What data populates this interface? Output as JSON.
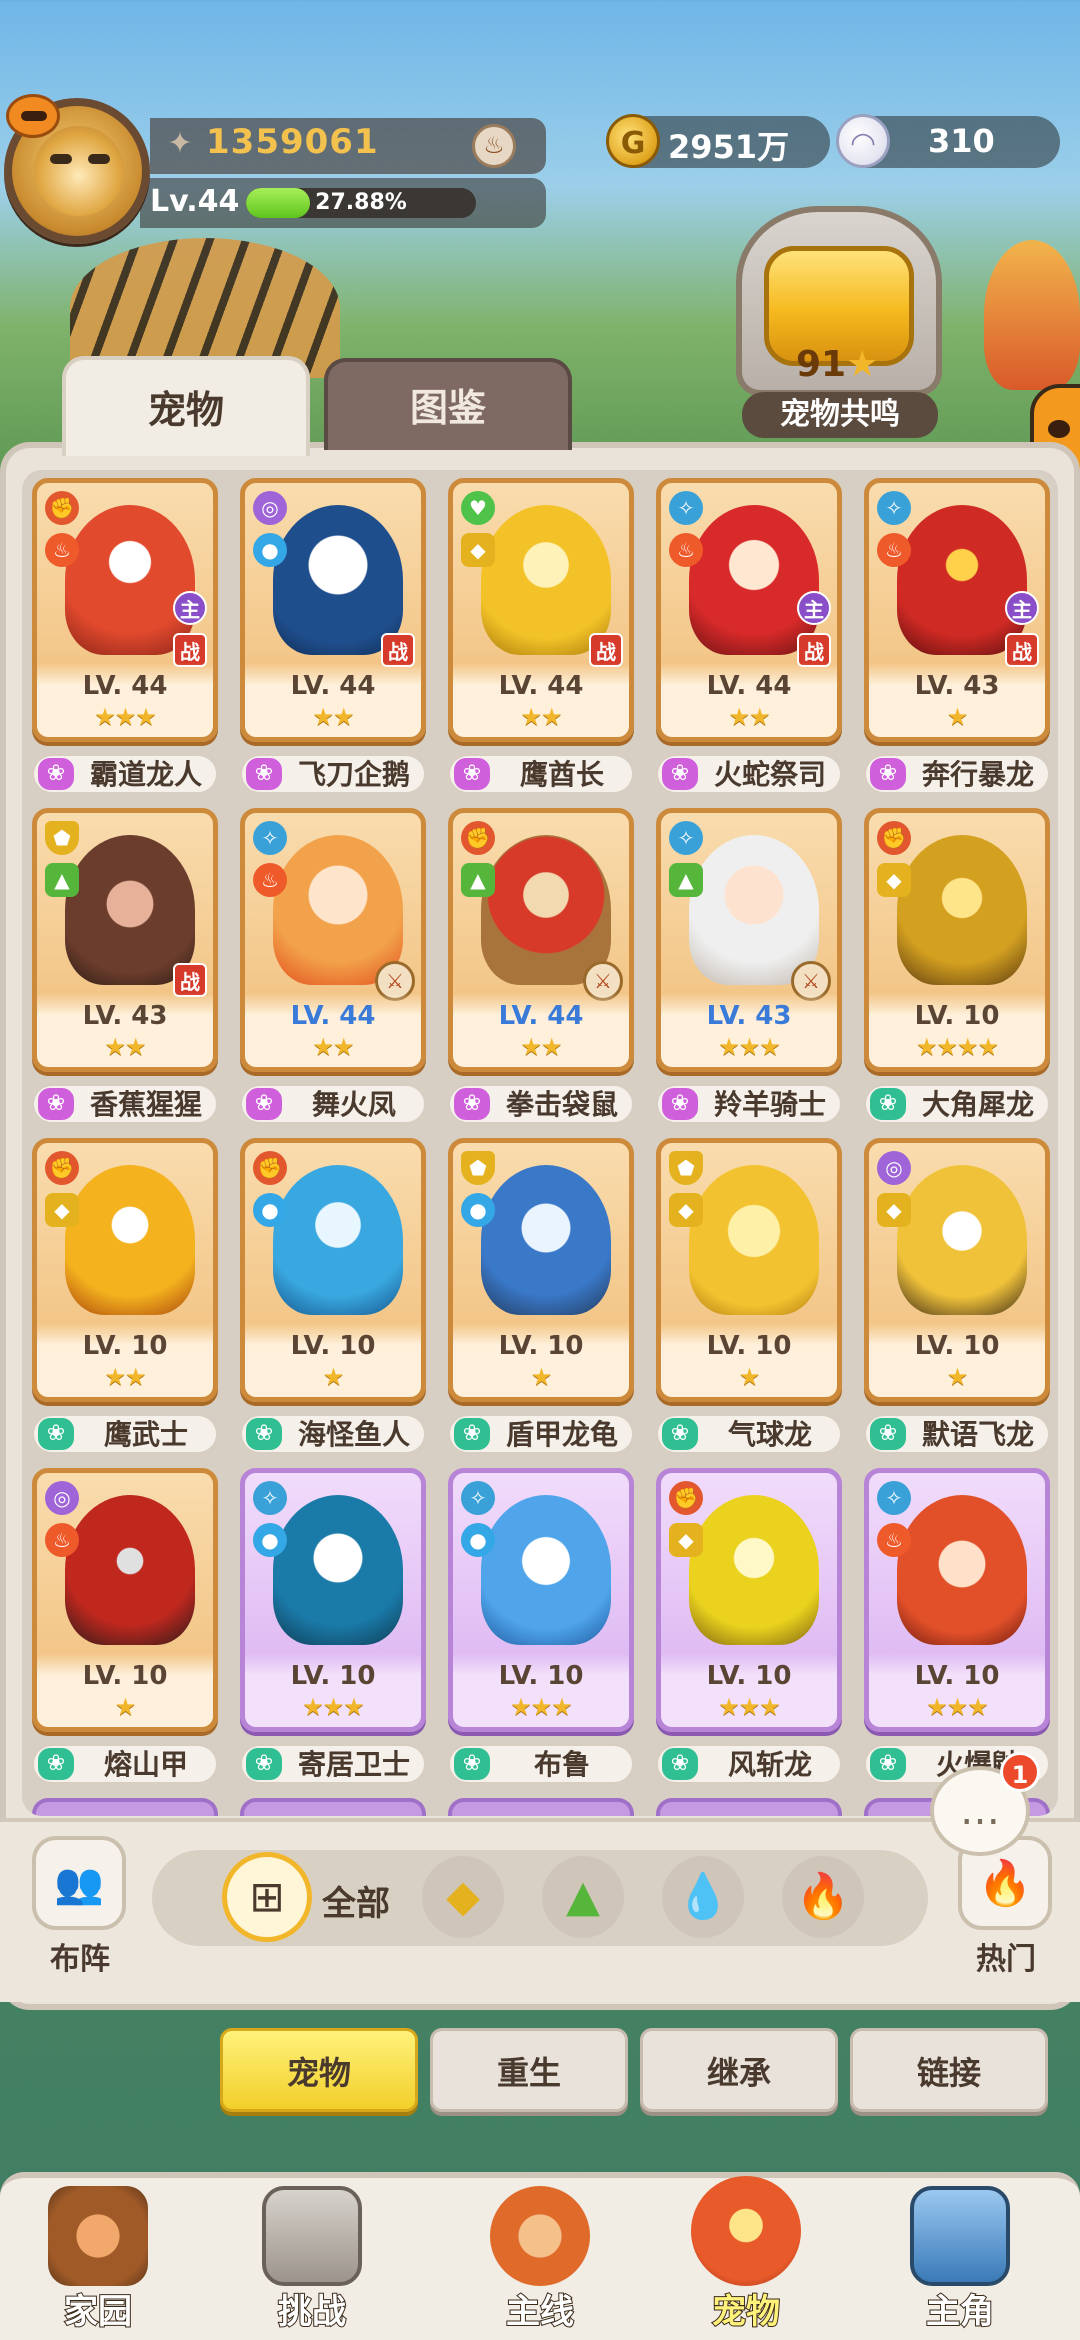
{
  "header": {
    "score": "1359061",
    "level": "Lv.44",
    "xp_percent": "27.88%",
    "xp_fraction": 0.2788,
    "gold": "2951万",
    "pearls": "310"
  },
  "resonance": {
    "count": "91",
    "label": "宠物共鸣"
  },
  "tabs": {
    "pets": "宠物",
    "atlas": "图鉴"
  },
  "pets": [
    {
      "name": "霸道龙人",
      "level": "LV. 44",
      "stars": "★★★",
      "main": "主",
      "battle": "战"
    },
    {
      "name": "飞刀企鹅",
      "level": "LV. 44",
      "stars": "★★",
      "battle": "战"
    },
    {
      "name": "鹰酋长",
      "level": "LV. 44",
      "stars": "★★",
      "battle": "战"
    },
    {
      "name": "火蛇祭司",
      "level": "LV. 44",
      "stars": "★★",
      "main": "主",
      "battle": "战"
    },
    {
      "name": "奔行暴龙",
      "level": "LV. 43",
      "stars": "★",
      "main": "主",
      "battle": "战"
    },
    {
      "name": "香蕉猩猩",
      "level": "LV. 43",
      "stars": "★★",
      "battle": "战"
    },
    {
      "name": "舞火凤",
      "level": "LV. 44",
      "stars": "★★"
    },
    {
      "name": "拳击袋鼠",
      "level": "LV. 44",
      "stars": "★★"
    },
    {
      "name": "羚羊骑士",
      "level": "LV. 43",
      "stars": "★★★"
    },
    {
      "name": "大角犀龙",
      "level": "LV. 10",
      "stars": "★★★★"
    },
    {
      "name": "鹰武士",
      "level": "LV. 10",
      "stars": "★★"
    },
    {
      "name": "海怪鱼人",
      "level": "LV. 10",
      "stars": "★"
    },
    {
      "name": "盾甲龙龟",
      "level": "LV. 10",
      "stars": "★"
    },
    {
      "name": "气球龙",
      "level": "LV. 10",
      "stars": "★"
    },
    {
      "name": "默语飞龙",
      "level": "LV. 10",
      "stars": "★"
    },
    {
      "name": "熔山甲",
      "level": "LV. 10",
      "stars": "★"
    },
    {
      "name": "寄居卫士",
      "level": "LV. 10",
      "stars": "★★★"
    },
    {
      "name": "布鲁",
      "level": "LV. 10",
      "stars": "★★★"
    },
    {
      "name": "风斩龙",
      "level": "LV. 10",
      "stars": "★★★"
    },
    {
      "name": "火爆鼬",
      "level": "LV. 10",
      "stars": "★★★"
    }
  ],
  "filters": {
    "formation": "布阵",
    "all": "全部",
    "hot": "热门",
    "chat_count": "1"
  },
  "subtabs": [
    "宠物",
    "重生",
    "继承",
    "链接"
  ],
  "nav": [
    "家园",
    "挑战",
    "主线",
    "宠物",
    "主角"
  ],
  "colors": {
    "accent_yellow": "#f2cf2a",
    "card_orange": "#cc8a3a",
    "card_purple": "#b784d8",
    "xp_green": "#5fc51d"
  }
}
